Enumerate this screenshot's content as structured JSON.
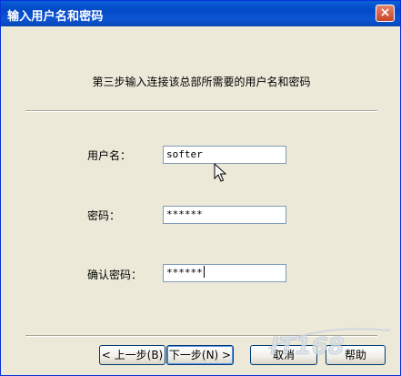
{
  "window": {
    "title": "输入用户名和密码",
    "close_glyph": "×"
  },
  "instruction": "第三步输入连接该总部所需要的用户名和密码",
  "form": {
    "username": {
      "label": "用户名：",
      "value": "softer"
    },
    "password": {
      "label": "密码：",
      "value": "******"
    },
    "confirm": {
      "label": "确认密码：",
      "value": "******"
    }
  },
  "buttons": {
    "back": "< 上一步(B)",
    "next": "下一步(N) >",
    "cancel": "取消",
    "help": "帮助"
  },
  "watermark": "IT168",
  "icons": {
    "close": "close-icon",
    "pointer": "mouse-pointer-icon"
  },
  "colors": {
    "titlebar": "#0349c7",
    "window_bg": "#ece9d8",
    "field_border": "#7f9db9"
  }
}
